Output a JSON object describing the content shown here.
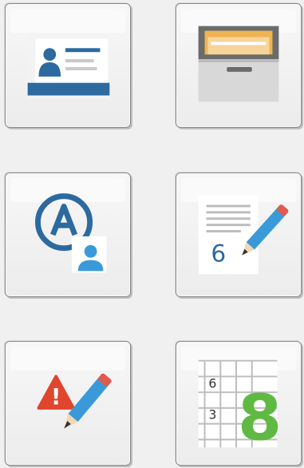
{
  "tiles": [
    {
      "name": "contact-card-button",
      "icon": "contact-card-icon"
    },
    {
      "name": "file-drawer-button",
      "icon": "file-cabinet-drawer-icon"
    },
    {
      "name": "user-account-button",
      "icon": "account-a-user-icon"
    },
    {
      "name": "edit-number-document-button",
      "icon": "document-pencil-number-icon",
      "number": "6"
    },
    {
      "name": "edit-warning-button",
      "icon": "warning-pencil-icon",
      "warning_symbol": "!"
    },
    {
      "name": "number-grid-button",
      "icon": "number-grid-icon",
      "small_numbers": [
        "6",
        "3"
      ],
      "large_number": "8"
    }
  ],
  "colors": {
    "blue": "#2c6aa0",
    "light_blue": "#3a9ad9",
    "orange": "#e8a33a",
    "red": "#e0452e",
    "green": "#5fb942",
    "pencil_tip": "#e05a4f"
  }
}
